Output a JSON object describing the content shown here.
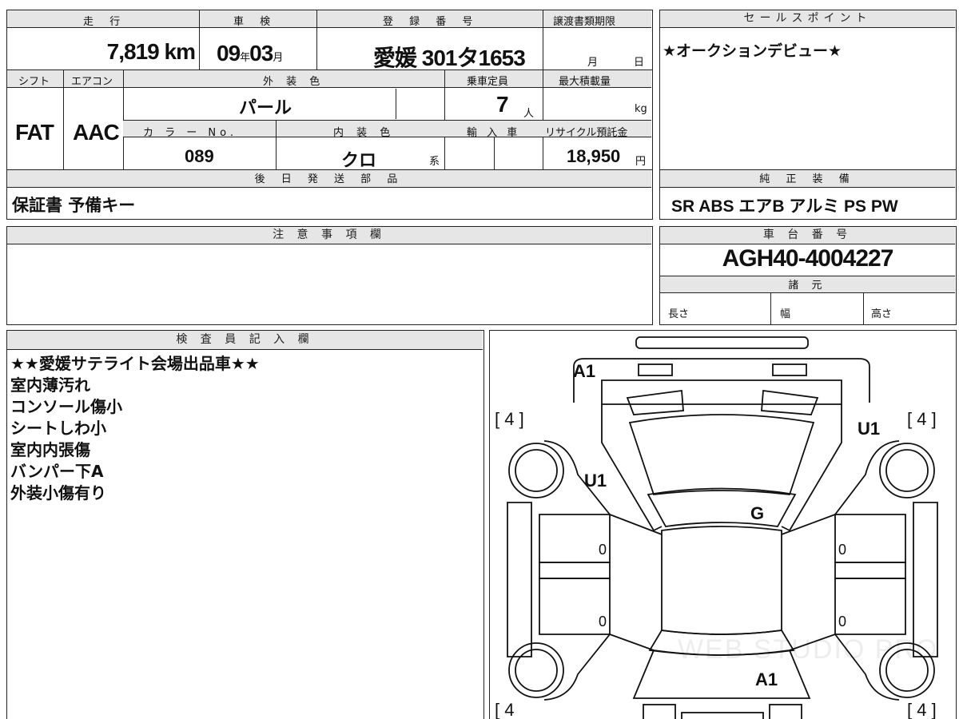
{
  "header": {
    "mileage_label": "走 行",
    "inspection_label": "車 検",
    "registration_label": "登 録 番 号",
    "transfer_deadline_label": "譲渡書類期限",
    "sales_point_label": "セールスポイント"
  },
  "values": {
    "mileage": "7,819",
    "mileage_unit": "km",
    "inspection_year": "09",
    "year_unit": "年",
    "inspection_month": "03",
    "month_unit": "月",
    "registration": "愛媛 301タ1653",
    "transfer_month_unit": "月",
    "transfer_day_unit": "日",
    "sales_point": "★オークションデビュー★"
  },
  "row2": {
    "shift_label": "シフト",
    "ac_label": "エアコン",
    "exterior_color_label": "外 装 色",
    "capacity_label": "乗車定員",
    "max_load_label": "最大積載量",
    "shift": "FAT",
    "ac": "AAC",
    "exterior_color": "パール",
    "capacity": "7",
    "capacity_unit": "人",
    "max_load_unit": "kg",
    "color_no_label": "カ ラ ー No.",
    "interior_color_label": "内 装 色",
    "import_label": "輸 入 車",
    "recycle_label": "リサイクル預託金",
    "color_no": "089",
    "interior_color": "クロ",
    "interior_suffix": "系",
    "recycle_fee": "18,950",
    "recycle_unit": "円"
  },
  "later_parts": {
    "label": "後 日 発 送 部 品",
    "value": "保証書 予備キー"
  },
  "genuine_equipment": {
    "label": "純 正 装 備",
    "value": "SR ABS エアB アルミ PS PW"
  },
  "notes": {
    "label": "注 意 事 項 欄"
  },
  "chassis": {
    "label": "車 台 番 号",
    "value": "AGH40-4004227",
    "specs_label": "諸 元",
    "length_label": "長さ",
    "width_label": "幅",
    "height_label": "高さ"
  },
  "inspector": {
    "label": "検 査 員 記 入 欄",
    "lines": [
      "★★愛媛サテライト会場出品車★★",
      "室内薄汚れ",
      "コンソール傷小",
      "シートしわ小",
      "室内内張傷",
      "バンパー下A",
      "外装小傷有り"
    ]
  },
  "diagram_marks": {
    "front_bumper": "A1",
    "rear_bumper": "A1",
    "left_front_fender": "U1",
    "right_front_fender": "U1",
    "windshield": "G",
    "door_lf": "0",
    "door_lr": "0",
    "door_rf": "0",
    "door_rr": "0",
    "tire_lf": "[ 4 ]",
    "tire_rf": "[ 4 ]",
    "tire_lr": "[ 4 ",
    "tire_rr": "[ 4 ]"
  },
  "watermark": "WEB STUDIO PRO"
}
